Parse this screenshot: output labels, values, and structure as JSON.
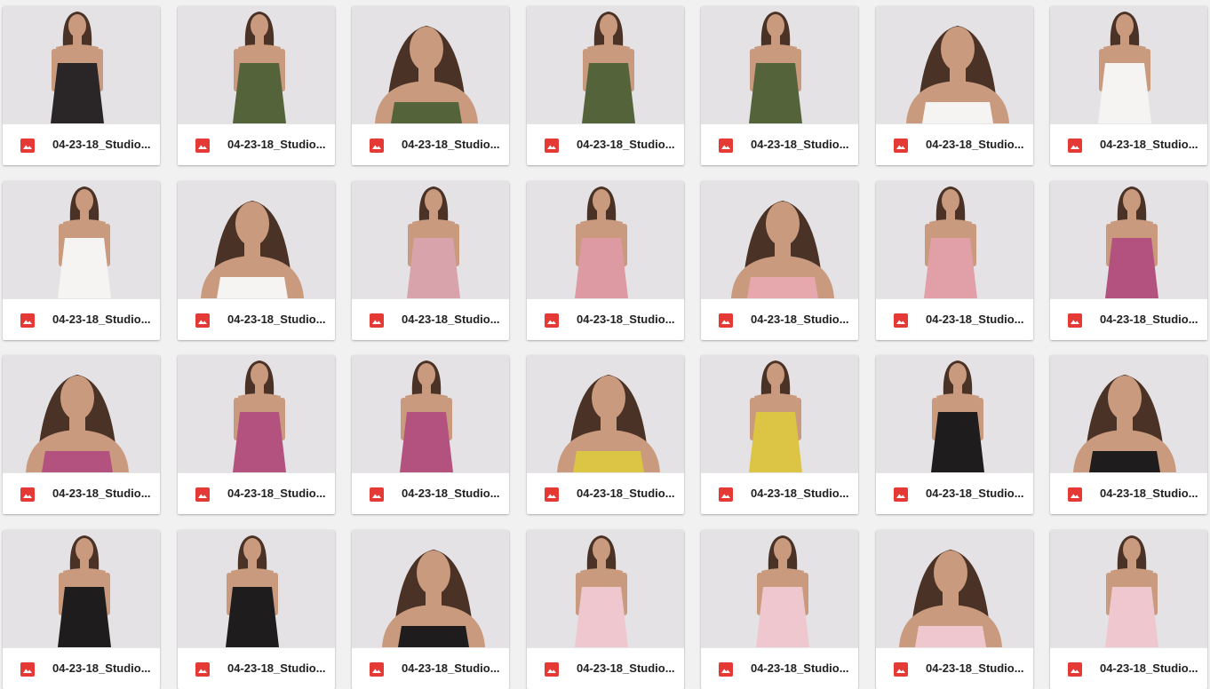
{
  "colors": {
    "background": "#f1f1f1",
    "image_file_icon": "#e53935",
    "thumbnail_backdrop": "#e4e2e4"
  },
  "file_icon": "image-file-icon",
  "files": [
    {
      "name": "04-23-18_Studio...",
      "outfit": "#2a2627"
    },
    {
      "name": "04-23-18_Studio...",
      "outfit": "#55633a"
    },
    {
      "name": "04-23-18_Studio...",
      "outfit": "#55633a"
    },
    {
      "name": "04-23-18_Studio...",
      "outfit": "#55633a"
    },
    {
      "name": "04-23-18_Studio...",
      "outfit": "#55633a"
    },
    {
      "name": "04-23-18_Studio...",
      "outfit": "#f6f4f2"
    },
    {
      "name": "04-23-18_Studio...",
      "outfit": "#f6f4f2"
    },
    {
      "name": "04-23-18_Studio...",
      "outfit": "#f6f4f2"
    },
    {
      "name": "04-23-18_Studio...",
      "outfit": "#f6f4f2"
    },
    {
      "name": "04-23-18_Studio...",
      "outfit": "#d9a3ab"
    },
    {
      "name": "04-23-18_Studio...",
      "outfit": "#dd9aa2"
    },
    {
      "name": "04-23-18_Studio...",
      "outfit": "#e6a7ad"
    },
    {
      "name": "04-23-18_Studio...",
      "outfit": "#e1a0a7"
    },
    {
      "name": "04-23-18_Studio...",
      "outfit": "#b3517f"
    },
    {
      "name": "04-23-18_Studio...",
      "outfit": "#b3517f"
    },
    {
      "name": "04-23-18_Studio...",
      "outfit": "#b3517f"
    },
    {
      "name": "04-23-18_Studio...",
      "outfit": "#b3517f"
    },
    {
      "name": "04-23-18_Studio...",
      "outfit": "#dcc444"
    },
    {
      "name": "04-23-18_Studio...",
      "outfit": "#dcc444"
    },
    {
      "name": "04-23-18_Studio...",
      "outfit": "#1e1c1d"
    },
    {
      "name": "04-23-18_Studio...",
      "outfit": "#1e1c1d"
    },
    {
      "name": "04-23-18_Studio...",
      "outfit": "#1e1c1d"
    },
    {
      "name": "04-23-18_Studio...",
      "outfit": "#1e1c1d"
    },
    {
      "name": "04-23-18_Studio...",
      "outfit": "#1e1c1d"
    },
    {
      "name": "04-23-18_Studio...",
      "outfit": "#efc8cf"
    },
    {
      "name": "04-23-18_Studio...",
      "outfit": "#efc8cf"
    },
    {
      "name": "04-23-18_Studio...",
      "outfit": "#efc8cf"
    },
    {
      "name": "04-23-18_Studio...",
      "outfit": "#efc8cf"
    }
  ]
}
